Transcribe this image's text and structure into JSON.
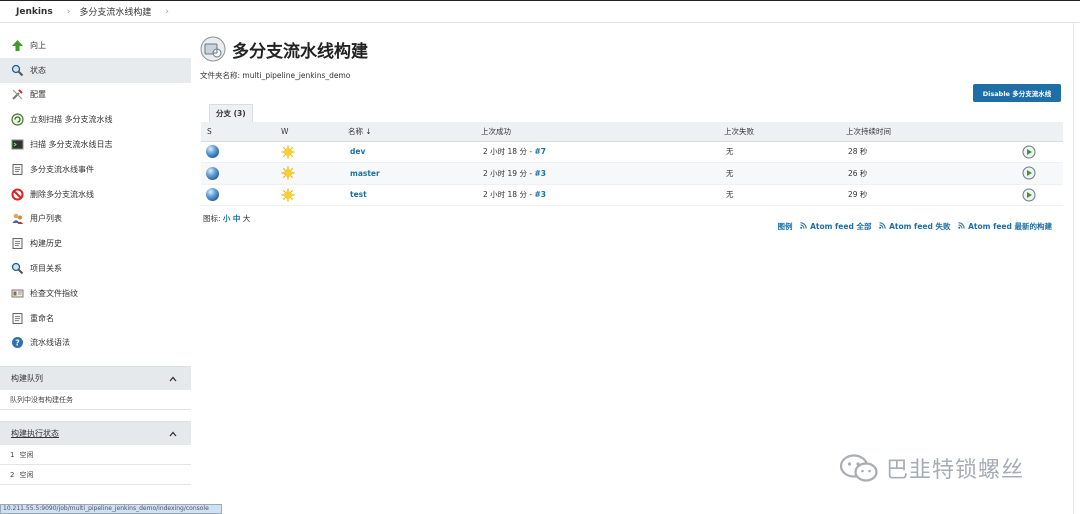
{
  "breadcrumb": {
    "home": "Jenkins",
    "job": "多分支流水线构建",
    "sep": "›"
  },
  "sidebar": {
    "items": [
      {
        "label": "向上",
        "icon": "up-arrow-icon"
      },
      {
        "label": "状态",
        "icon": "search-icon",
        "active": true
      },
      {
        "label": "配置",
        "icon": "wrench-icon"
      },
      {
        "label": "立刻扫描 多分支流水线",
        "icon": "scan-icon"
      },
      {
        "label": "扫描 多分支流水线日志",
        "icon": "terminal-icon"
      },
      {
        "label": "多分支流水线事件",
        "icon": "notepad-icon"
      },
      {
        "label": "删除多分支流水线",
        "icon": "delete-icon"
      },
      {
        "label": "用户列表",
        "icon": "users-icon"
      },
      {
        "label": "构建历史",
        "icon": "notepad-icon"
      },
      {
        "label": "项目关系",
        "icon": "search-icon"
      },
      {
        "label": "检查文件指纹",
        "icon": "fingerprint-icon"
      },
      {
        "label": "重命名",
        "icon": "notepad-icon"
      },
      {
        "label": "流水线语法",
        "icon": "help-icon"
      }
    ],
    "build_queue": {
      "title": "构建队列",
      "empty": "队列中没有构建任务"
    },
    "executors": {
      "title": "构建执行状态",
      "rows": [
        {
          "num": "1",
          "status": "空闲"
        },
        {
          "num": "2",
          "status": "空闲"
        }
      ]
    }
  },
  "main": {
    "title": "多分支流水线构建",
    "subtitle": "文件夹名称: multi_pipeline_jenkins_demo",
    "disable_button": "Disable 多分支流水线",
    "tab": "分支 (3)",
    "columns": {
      "s": "S",
      "w": "W",
      "name": "名称 ↓",
      "last_success": "上次成功",
      "last_failure": "上次失败",
      "last_duration": "上次持续时间"
    },
    "rows": [
      {
        "name": "dev",
        "success_time": "2 小时 18 分 - ",
        "success_build": "#7",
        "failure": "无",
        "duration": "28 秒"
      },
      {
        "name": "master",
        "success_time": "2 小时 19 分 - ",
        "success_build": "#3",
        "failure": "无",
        "duration": "26 秒"
      },
      {
        "name": "test",
        "success_time": "2 小时 18 分 - ",
        "success_build": "#3",
        "failure": "无",
        "duration": "29 秒"
      }
    ],
    "icon_size": {
      "label": "图标: ",
      "small": "小",
      "medium": "中",
      "large": "大"
    },
    "feeds": {
      "legend": "图例",
      "all": "Atom feed 全部",
      "failed": "Atom feed 失败",
      "latest": "Atom feed 最新的构建"
    }
  },
  "status_url": "10.211.55.5:9090/job/multi_pipeline_jenkins_demo/indexing/console",
  "watermark": "巴韭特锁螺丝",
  "colors": {
    "accent": "#1d6fa5",
    "sidebar_active": "#e7ebee",
    "header_bg": "#eef1f3"
  }
}
